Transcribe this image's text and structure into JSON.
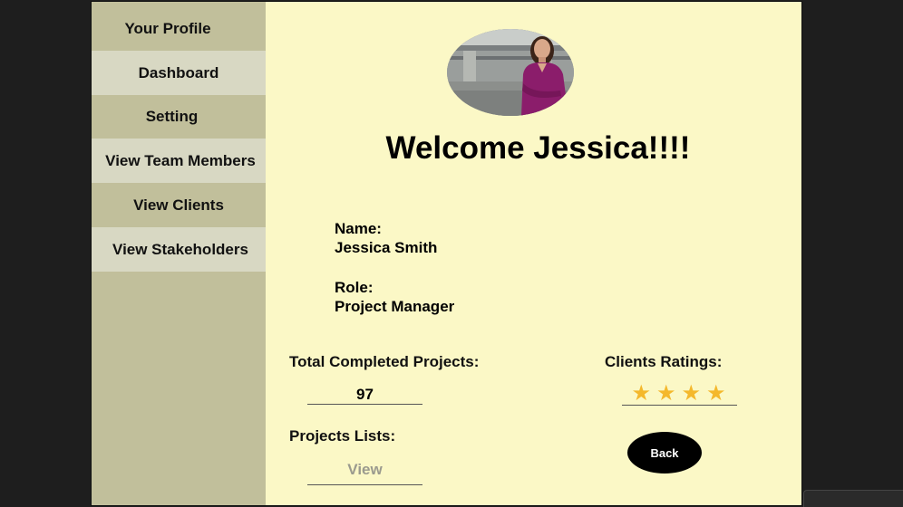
{
  "sidebar": {
    "items": [
      {
        "label": "Your Profile"
      },
      {
        "label": "Dashboard"
      },
      {
        "label": "Setting"
      },
      {
        "label": "View Team Members"
      },
      {
        "label": "View Clients"
      },
      {
        "label": "View Stakeholders"
      }
    ]
  },
  "header": {
    "welcome": "Welcome Jessica!!!!"
  },
  "profile": {
    "name_label": "Name:",
    "name_value": "Jessica Smith",
    "role_label": "Role:",
    "role_value": "Project Manager"
  },
  "stats": {
    "completed_label": "Total Completed Projects:",
    "completed_value": "97",
    "ratings_label": "Clients Ratings:",
    "rating_stars": 4,
    "projects_label": "Projects Lists:",
    "projects_link": "View"
  },
  "actions": {
    "back_label": "Back"
  },
  "colors": {
    "sidebar": "#c1bf9b",
    "sidebar_highlight": "#d8d8c3",
    "content_bg": "#fbf8c6",
    "star": "#f4b82c",
    "back_button": "#000000"
  }
}
